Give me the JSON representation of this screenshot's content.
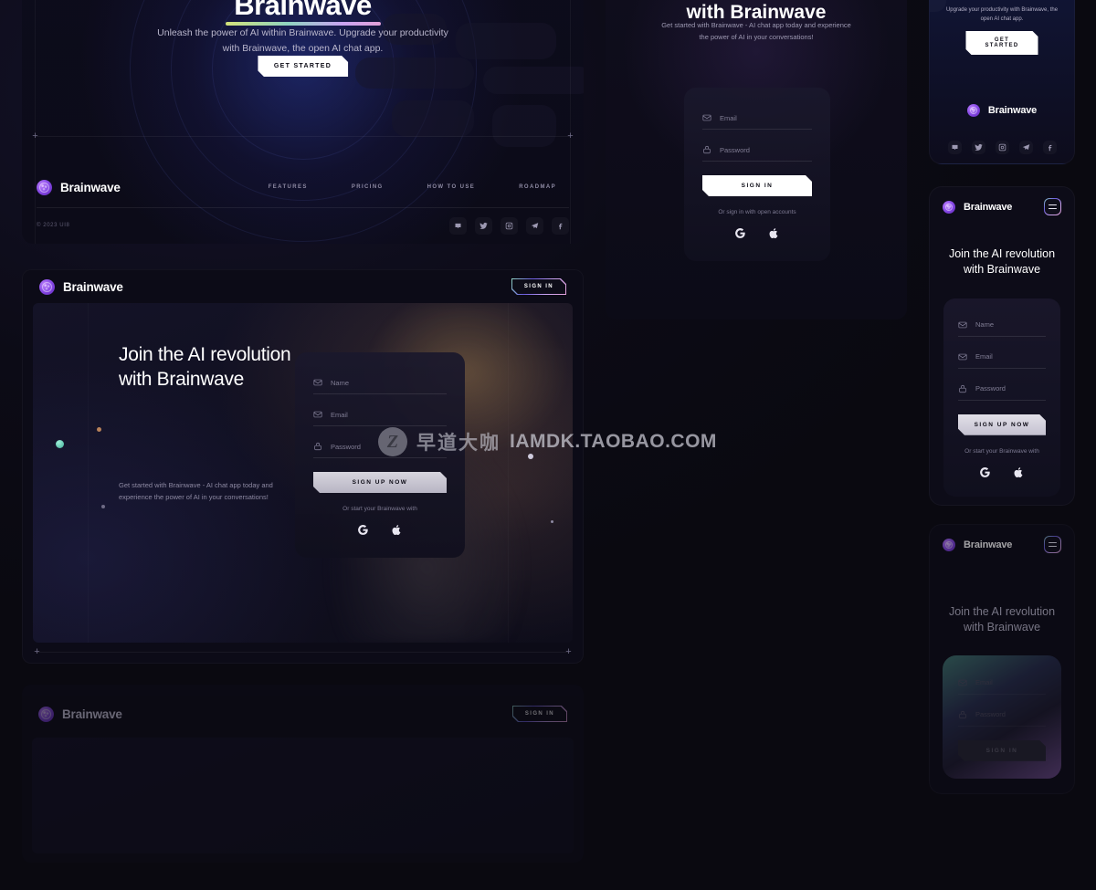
{
  "brand": {
    "name": "Brainwave"
  },
  "hero": {
    "title": "Brainwave",
    "subtitle": "Unleash the power of AI within Brainwave. Upgrade your productivity with Brainwave, the open AI chat app.",
    "cta": "GET STARTED"
  },
  "footer": {
    "nav": [
      {
        "label": "FEATURES"
      },
      {
        "label": "PRICING"
      },
      {
        "label": "HOW TO USE"
      },
      {
        "label": "ROADMAP"
      }
    ],
    "copyright": "© 2023 UI8",
    "socials": [
      {
        "name": "discord-icon"
      },
      {
        "name": "twitter-icon"
      },
      {
        "name": "instagram-icon"
      },
      {
        "name": "telegram-icon"
      },
      {
        "name": "facebook-icon"
      }
    ]
  },
  "signin_panel": {
    "title": "with Brainwave",
    "subtitle": "Get started with Brainwave - AI chat app today and experience the power of AI in your conversations!",
    "fields": [
      {
        "icon": "mail-icon",
        "placeholder": "Email"
      },
      {
        "icon": "lock-icon",
        "placeholder": "Password"
      }
    ],
    "submit": "SIGN IN",
    "or_text": "Or sign in with open accounts",
    "oauth": [
      {
        "name": "google-icon"
      },
      {
        "name": "apple-icon"
      }
    ]
  },
  "signup_panel": {
    "header_cta": "SIGN IN",
    "heading": "Join the AI revolution with Brainwave",
    "subtitle": "Get started with Brainwave - AI chat app today and experience the power of AI in your conversations!",
    "fields": [
      {
        "icon": "mail-icon",
        "placeholder": "Name"
      },
      {
        "icon": "mail-icon",
        "placeholder": "Email"
      },
      {
        "icon": "lock-icon",
        "placeholder": "Password"
      }
    ],
    "submit": "SIGN UP NOW",
    "or_text": "Or start your Brainwave with",
    "oauth": [
      {
        "name": "google-icon"
      },
      {
        "name": "apple-icon"
      }
    ]
  },
  "faded_panel": {
    "header_cta": "SIGN IN"
  },
  "phone_hero": {
    "subtitle": "Upgrade your productivity with Brainwave, the open AI chat app.",
    "cta": "GET STARTED"
  },
  "phone_signup": {
    "heading": "Join the AI revolution with Brainwave",
    "fields": [
      {
        "icon": "mail-icon",
        "placeholder": "Name"
      },
      {
        "icon": "mail-icon",
        "placeholder": "Email"
      },
      {
        "icon": "lock-icon",
        "placeholder": "Password"
      }
    ],
    "submit": "SIGN UP NOW",
    "or_text": "Or start your Brainwave with",
    "oauth": [
      {
        "name": "google-icon"
      },
      {
        "name": "apple-icon"
      }
    ]
  },
  "phone_signin": {
    "heading": "Join the AI revolution with Brainwave",
    "fields": [
      {
        "icon": "mail-icon",
        "placeholder": "Email"
      },
      {
        "icon": "lock-icon",
        "placeholder": "Password"
      }
    ],
    "submit": "SIGN IN"
  },
  "watermark": {
    "badge": "Z",
    "cn": "早道大咖",
    "en": "IAMDK.TAOBAO.COM"
  },
  "colors": {
    "background": "#0b0a14",
    "panel": "#0c0b17",
    "accent_purple": "#8b4ee8",
    "accent_teal": "#6fd8c0",
    "accent_pink": "#e2a0d8",
    "text_primary": "#ffffff",
    "text_muted": "#8d89a2"
  }
}
